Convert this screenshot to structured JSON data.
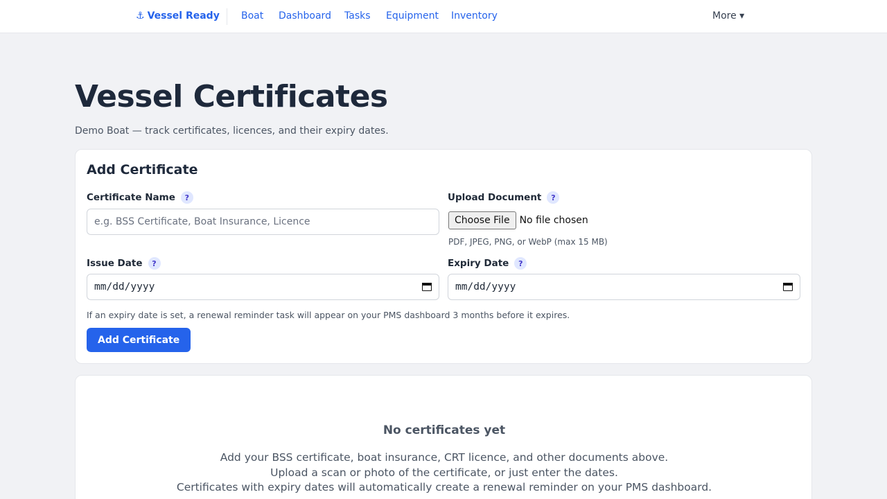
{
  "nav": {
    "brand_icon": "⚓",
    "brand": "Vessel Ready",
    "links": [
      "Boat",
      "Dashboard",
      "Tasks",
      "Equipment",
      "Inventory"
    ],
    "more": "More ▾"
  },
  "page": {
    "title": "Vessel Certificates",
    "subtitle": "Demo Boat — track certificates, licences, and their expiry dates."
  },
  "form": {
    "heading": "Add Certificate",
    "help_glyph": "?",
    "name_label": "Certificate Name",
    "name_placeholder": "e.g. BSS Certificate, Boat Insurance, Licence",
    "upload_label": "Upload Document",
    "choose_file": "Choose File",
    "no_file": "No file chosen",
    "file_hint": "PDF, JPEG, PNG, or WebP (max 15 MB)",
    "issue_label": "Issue Date",
    "expiry_label": "Expiry Date",
    "date_placeholder": "mm/dd/yyyy",
    "reminder_note": "If an expiry date is set, a renewal reminder task will appear on your PMS dashboard 3 months before it expires.",
    "submit": "Add Certificate"
  },
  "empty": {
    "title": "No certificates yet",
    "lines": [
      "Add your BSS certificate, boat insurance, CRT licence, and other documents above.",
      "Upload a scan or photo of the certificate, or just enter the dates.",
      "Certificates with expiry dates will automatically create a renewal reminder on your PMS dashboard."
    ]
  },
  "colors": {
    "accent": "#2563eb",
    "background": "#f1f2f5",
    "help_badge": "#e0e7ff"
  },
  "icons": [
    "anchor-icon",
    "help-icon",
    "calendar-icon",
    "chevron-down-icon"
  ]
}
